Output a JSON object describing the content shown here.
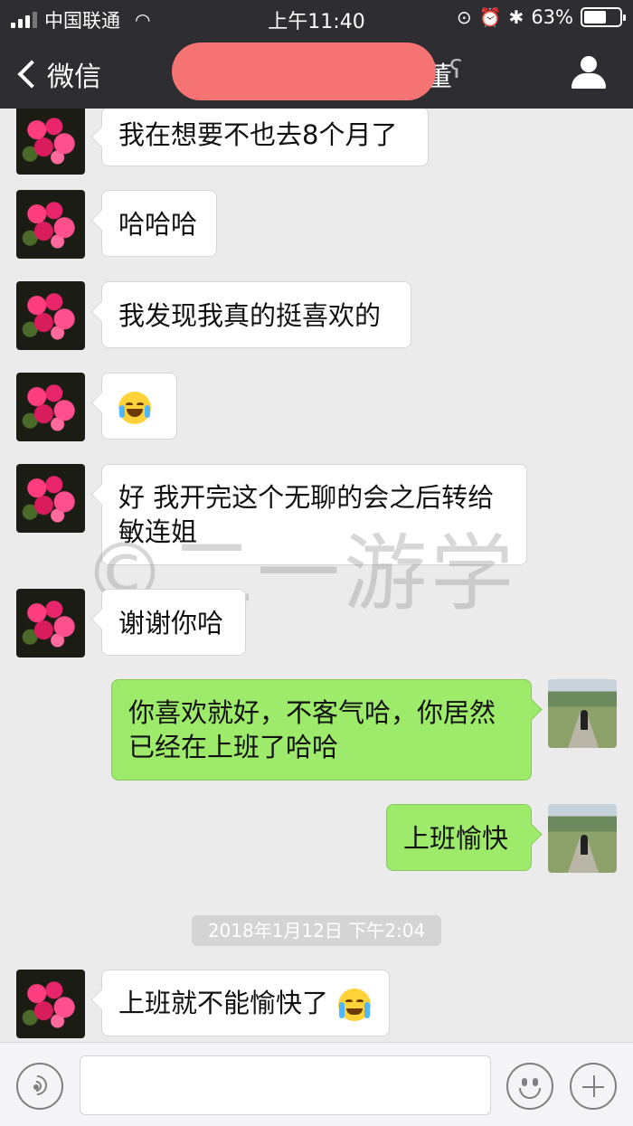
{
  "status": {
    "carrier": "中国联通",
    "time": "上午11:40",
    "battery": "63%",
    "battery_level": 0.63
  },
  "nav": {
    "back_label": "微信",
    "title_visible_fragment": "董"
  },
  "messages": [
    {
      "side": "in",
      "text": "我在想要不也去8个月了"
    },
    {
      "side": "in",
      "text": "哈哈哈"
    },
    {
      "side": "in",
      "text": "我发现我真的挺喜欢的"
    },
    {
      "side": "in",
      "text": "",
      "emoji": "joy-emoji"
    },
    {
      "side": "in",
      "text": "好 我开完这个无聊的会之后转给敏连姐"
    },
    {
      "side": "in",
      "text": "谢谢你哈"
    },
    {
      "side": "out",
      "text": "你喜欢就好，不客气哈，你居然已经在上班了哈哈"
    },
    {
      "side": "out",
      "text": "上班愉快"
    },
    {
      "side": "in",
      "text": "上班就不能愉快了",
      "emoji": "crying-emoji"
    }
  ],
  "timestamp": "2018年1月12日 下午2:04",
  "watermark": "©二一游学",
  "toolbar": {
    "voice_icon": "voice-icon",
    "emoji_icon": "emoji-icon",
    "plus_icon": "plus-icon"
  }
}
